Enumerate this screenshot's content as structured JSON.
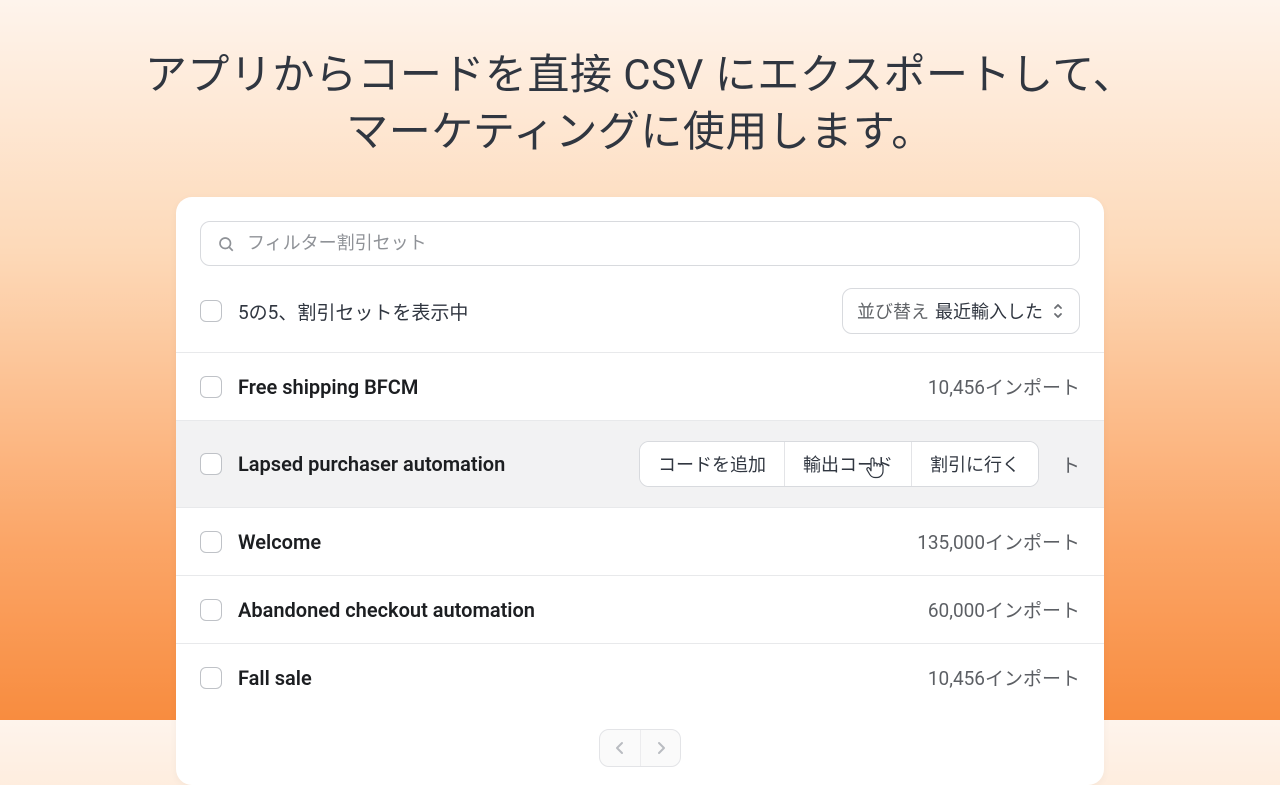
{
  "headline": "アプリからコードを直接 CSV にエクスポートして、マーケティングに使用します。",
  "search": {
    "placeholder": "フィルター割引セット"
  },
  "list_header": {
    "showing": "5の5、割引セットを表示中",
    "sort_label": "並び替え",
    "sort_value": "最近輸入した"
  },
  "rows": [
    {
      "title": "Free shipping BFCM",
      "count": "10,456インポート",
      "hover": false
    },
    {
      "title": "Lapsed purchaser automation",
      "count": "",
      "hover": true,
      "trailing_cut": "ト"
    },
    {
      "title": "Welcome",
      "count": "135,000インポート",
      "hover": false
    },
    {
      "title": "Abandoned checkout automation",
      "count": "60,000インポート",
      "hover": false
    },
    {
      "title": "Fall sale",
      "count": "10,456インポート",
      "hover": false
    }
  ],
  "row_actions": {
    "add_codes": "コードを追加",
    "export_codes": "輸出コード",
    "go_to_discount": "割引に行く"
  }
}
